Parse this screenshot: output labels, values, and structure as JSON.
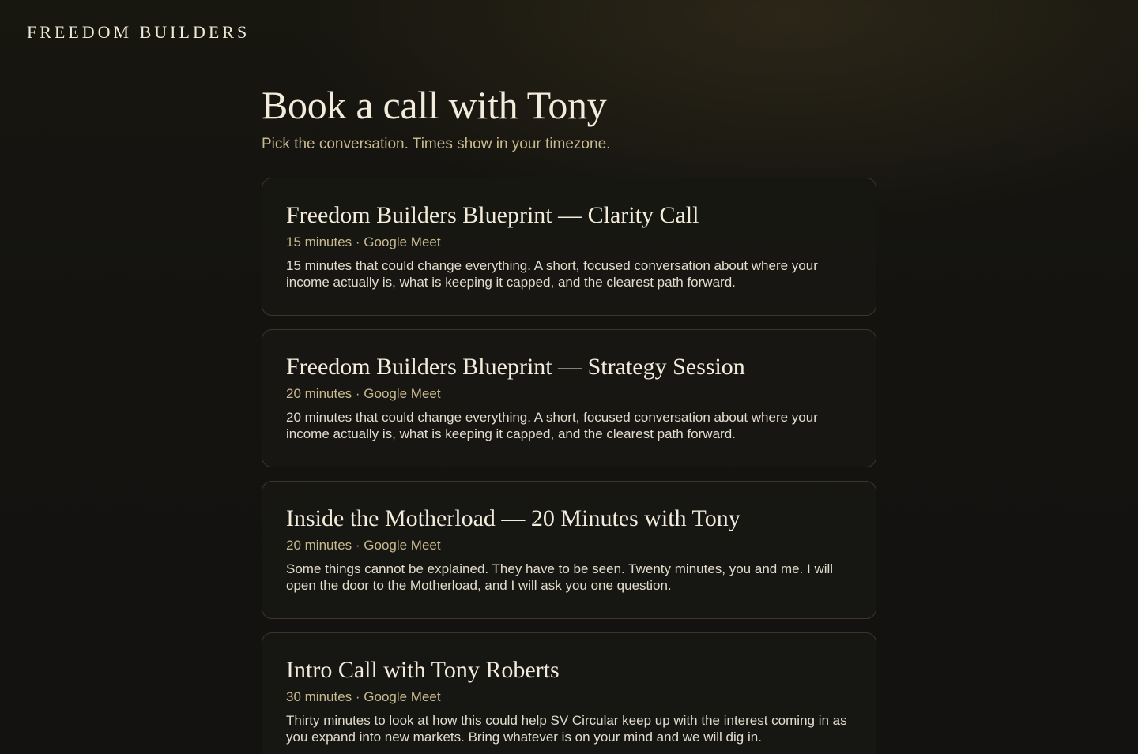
{
  "brand": "FREEDOM BUILDERS",
  "header": {
    "title": "Book a call with Tony",
    "subtitle": "Pick the conversation. Times show in your timezone."
  },
  "events": [
    {
      "title": "Freedom Builders Blueprint — Clarity Call",
      "meta": "15 minutes · Google Meet",
      "description": "15 minutes that could change everything. A short, focused conversation about where your income actually is, what is keeping it capped, and the clearest path forward."
    },
    {
      "title": "Freedom Builders Blueprint — Strategy Session",
      "meta": "20 minutes · Google Meet",
      "description": "20 minutes that could change everything. A short, focused conversation about where your income actually is, what is keeping it capped, and the clearest path forward."
    },
    {
      "title": "Inside the Motherload — 20 Minutes with Tony",
      "meta": "20 minutes · Google Meet",
      "description": "Some things cannot be explained. They have to be seen. Twenty minutes, you and me. I will open the door to the Motherload, and I will ask you one question."
    },
    {
      "title": "Intro Call with Tony Roberts",
      "meta": "30 minutes · Google Meet",
      "description": "Thirty minutes to look at how this could help SV Circular keep up with the interest coming in as you expand into new markets. Bring whatever is on your mind and we will dig in."
    }
  ],
  "colors": {
    "background": "#141310",
    "accent": "#c9b98f",
    "text": "#f3ecdc",
    "card_border": "#3a362c"
  }
}
